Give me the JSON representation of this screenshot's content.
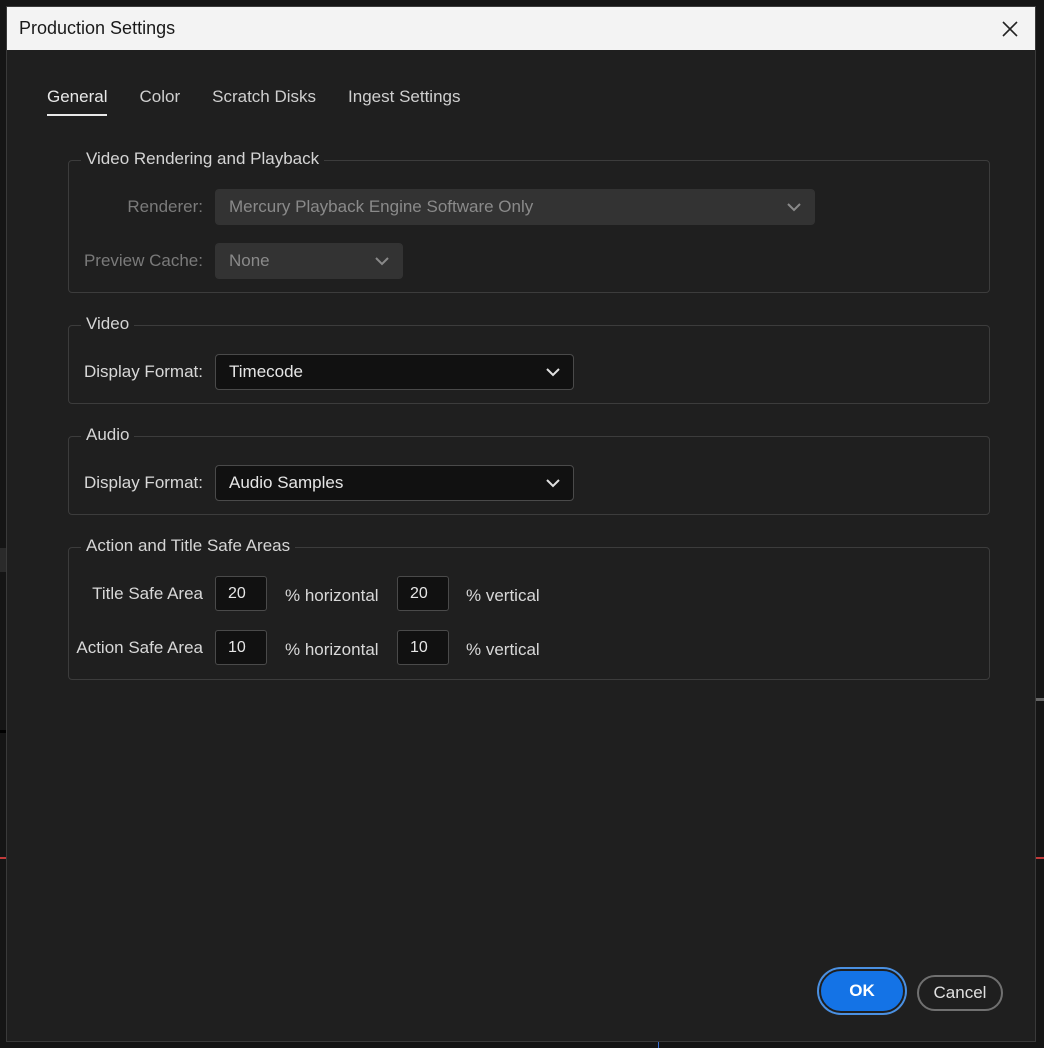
{
  "window": {
    "title": "Production Settings"
  },
  "tabs": [
    {
      "label": "General",
      "active": true
    },
    {
      "label": "Color",
      "active": false
    },
    {
      "label": "Scratch Disks",
      "active": false
    },
    {
      "label": "Ingest Settings",
      "active": false
    }
  ],
  "video_rendering": {
    "legend": "Video Rendering and Playback",
    "renderer_label": "Renderer:",
    "renderer_value": "Mercury Playback Engine Software Only",
    "preview_cache_label": "Preview Cache:",
    "preview_cache_value": "None"
  },
  "video": {
    "legend": "Video",
    "display_format_label": "Display Format:",
    "display_format_value": "Timecode"
  },
  "audio": {
    "legend": "Audio",
    "display_format_label": "Display Format:",
    "display_format_value": "Audio Samples"
  },
  "safe_areas": {
    "legend": "Action and Title Safe Areas",
    "title_safe_label": "Title Safe Area",
    "title_safe_horizontal": "20",
    "title_safe_vertical": "20",
    "action_safe_label": "Action Safe Area",
    "action_safe_horizontal": "10",
    "action_safe_vertical": "10",
    "horizontal_unit": "% horizontal",
    "vertical_unit": "% vertical"
  },
  "buttons": {
    "ok": "OK",
    "cancel": "Cancel"
  },
  "icons": {
    "close": "close-icon",
    "chevron": "chevron-down-icon"
  },
  "colors": {
    "accent": "#1473e6",
    "dialog_bg": "#1f1f1f",
    "titlebar_bg": "#f3f3f3"
  }
}
